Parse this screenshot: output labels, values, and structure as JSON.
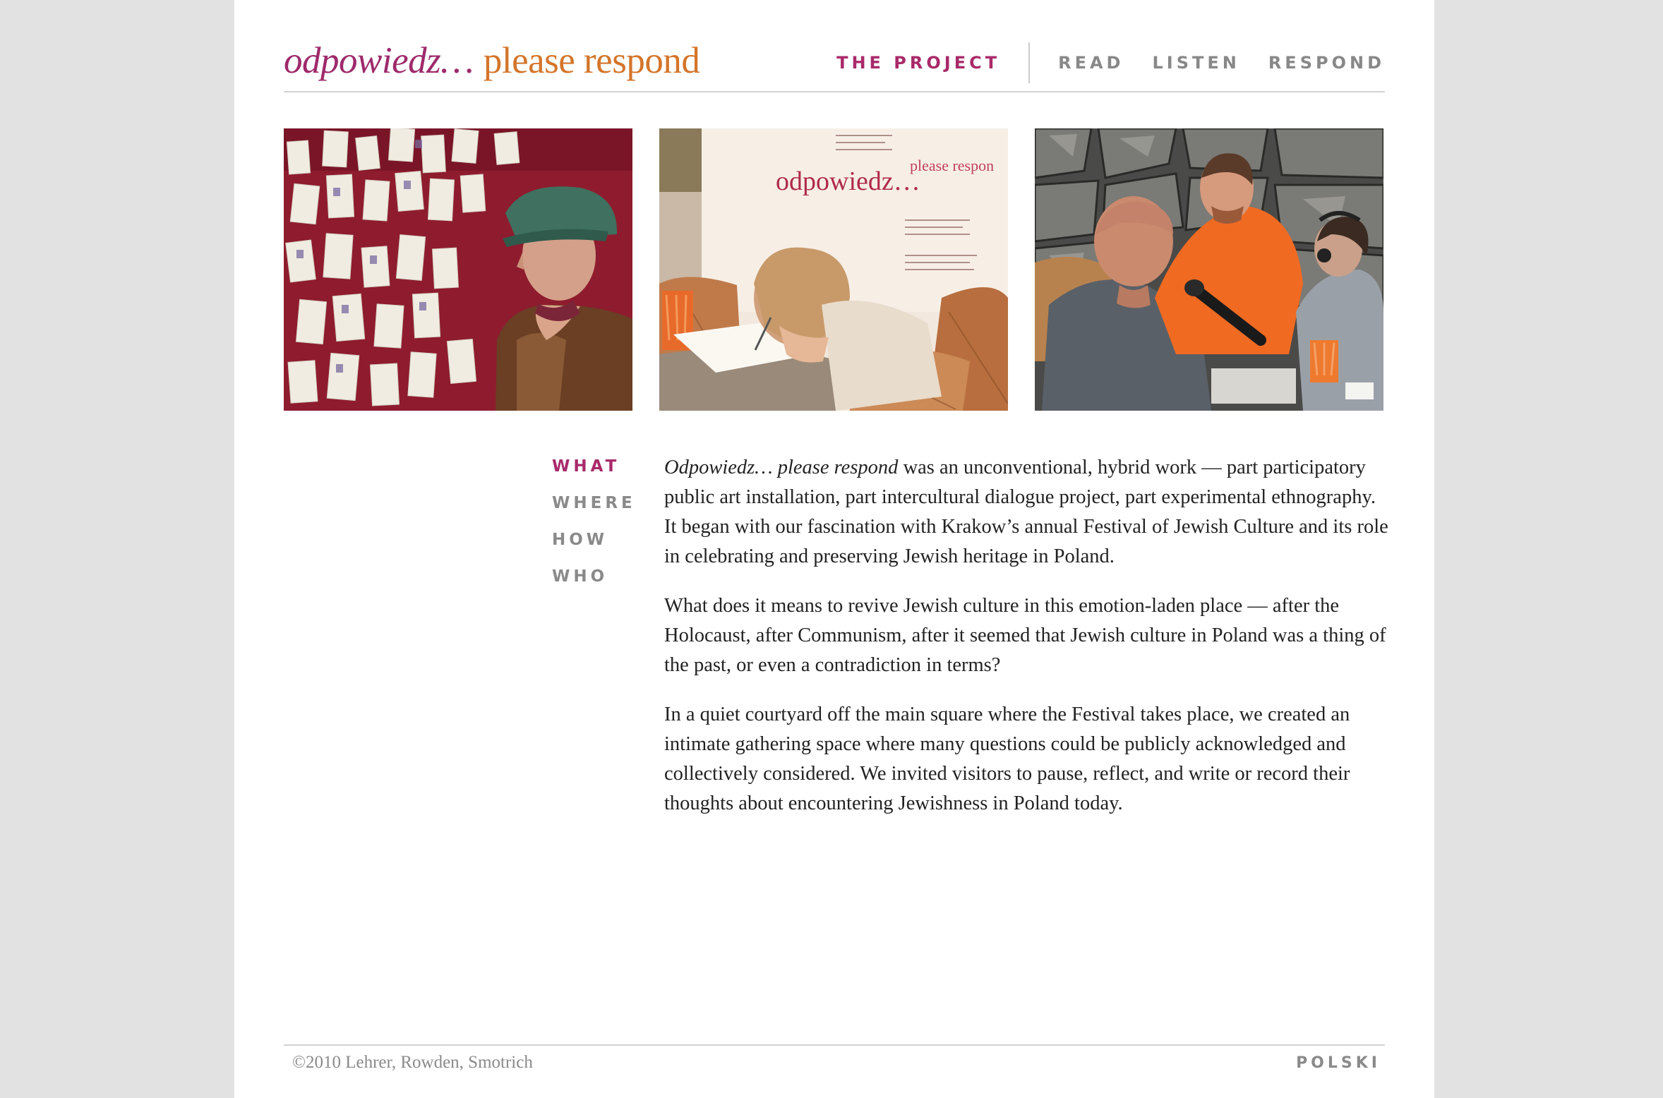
{
  "logo": {
    "part1": "odpowiedz…",
    "part2": "please respond"
  },
  "nav": {
    "items": [
      {
        "label": "THE PROJECT",
        "active": true
      },
      {
        "label": "READ",
        "active": false
      },
      {
        "label": "LISTEN",
        "active": false
      },
      {
        "label": "RESPOND",
        "active": false
      }
    ]
  },
  "photos": {
    "photo2_sign": {
      "title": "odpowiedz…",
      "subtitle": "please respon"
    }
  },
  "subnav": {
    "items": [
      {
        "label": "WHAT",
        "active": true
      },
      {
        "label": "WHERE",
        "active": false
      },
      {
        "label": "HOW",
        "active": false
      },
      {
        "label": "WHO",
        "active": false
      }
    ]
  },
  "content": {
    "p1_title": "Odpowiedz… please respond",
    "p1_rest": " was an unconventional, hybrid work — part participatory public art installation, part intercultural dialogue project, part experimental ethnography. It began with our fascination with Krakow’s annual Festival of Jewish Culture and its role in celebrating and preserving Jewish heritage in Poland.",
    "p2": "What does it means to revive Jewish culture in this emotion-laden place — after the Holocaust, after Communism, after it seemed that Jewish culture in Poland was a thing of the past, or even a contradiction in terms?",
    "p3": "In a quiet courtyard off the main square where the Festival takes place, we created an intimate gathering space where many questions could be publicly acknowledged and collectively considered. We invited visitors to pause, reflect, and write or record their thoughts about encountering Jewishness in Poland today."
  },
  "footer": {
    "copyright": "©2010 Lehrer, Rowden, Smotrich",
    "language_link": "POLSKI"
  }
}
